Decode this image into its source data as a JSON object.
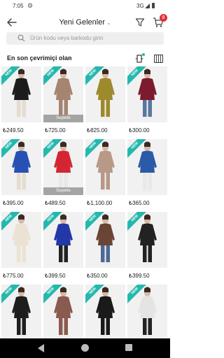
{
  "status": {
    "time": "7:05",
    "network": "3G"
  },
  "header": {
    "title": "Yeni Gelenler",
    "cart_count": "8"
  },
  "search": {
    "placeholder": "Ürün kodu veya barkodu girin"
  },
  "sort": {
    "label": "En son çevrimiçi olan"
  },
  "colors": {
    "accent": "#19c2a6",
    "new_tag": "#25b8ad",
    "badge": "#e0303a"
  },
  "products": [
    {
      "price": "₺249.50",
      "new": true,
      "sepette": false,
      "color": "#1c1c1c",
      "pants": "#e4dcd0"
    },
    {
      "price": "₺725.00",
      "new": true,
      "sepette": true,
      "sepette_label": "Sepette",
      "color": "#a58472",
      "pants": "#a58472"
    },
    {
      "price": "₺825.00",
      "new": true,
      "sepette": false,
      "color": "#9c8a2c",
      "pants": "#9c8a2c"
    },
    {
      "price": "₺300.00",
      "new": true,
      "sepette": false,
      "color": "#7c1a2e",
      "pants": "#5a76a0"
    },
    {
      "price": "₺395.00",
      "new": true,
      "sepette": false,
      "color": "#2750b4",
      "pants": "#e4dcd0"
    },
    {
      "price": "₺489.50",
      "new": true,
      "sepette": true,
      "sepette_label": "Sepette",
      "color": "#d42632",
      "pants": "#e8e8e8"
    },
    {
      "price": "₺1,100.00",
      "new": true,
      "sepette": false,
      "color": "#b89886",
      "pants": "#b89886"
    },
    {
      "price": "₺365.00",
      "new": true,
      "sepette": false,
      "color": "#2a5aa8",
      "pants": "#e8e8e8"
    },
    {
      "price": "₺775.00",
      "new": true,
      "sepette": false,
      "color": "#ece2d4",
      "pants": "#ece2d4"
    },
    {
      "price": "₺399.50",
      "new": true,
      "sepette": false,
      "color": "#2238a8",
      "pants": "#222222"
    },
    {
      "price": "₺350.00",
      "new": true,
      "sepette": false,
      "color": "#6a4434",
      "pants": "#4a6a94"
    },
    {
      "price": "₺399.50",
      "new": true,
      "sepette": false,
      "color": "#222222",
      "pants": "#222222"
    },
    {
      "price": "",
      "new": true,
      "sepette": false,
      "color": "#1e1e1e",
      "pants": "#1e1e1e"
    },
    {
      "price": "",
      "new": true,
      "sepette": false,
      "color": "#8a5a4e",
      "pants": "#8a5a4e"
    },
    {
      "price": "",
      "new": true,
      "sepette": false,
      "color": "#1a1a1a",
      "pants": "#1a1a1a"
    },
    {
      "price": "",
      "new": true,
      "sepette": false,
      "color": "#e4e4e4",
      "pants": "#222222"
    }
  ],
  "new_label": "NEW"
}
